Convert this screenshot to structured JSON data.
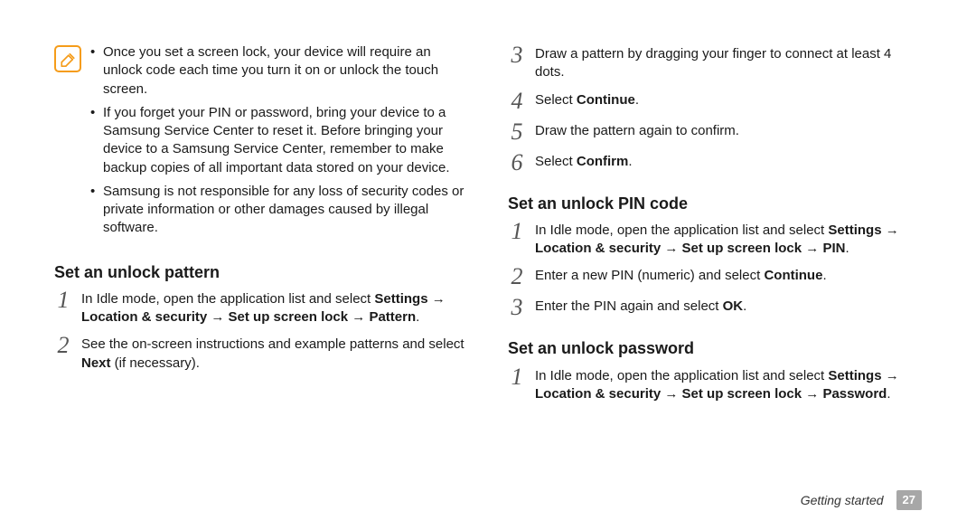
{
  "note": {
    "icon": "note-icon",
    "bullets": [
      "Once you set a screen lock, your device will require an unlock code each time you turn it on or unlock the touch screen.",
      "If you forget your PIN or password, bring your device to a Samsung Service Center to reset it. Before bringing your device to a Samsung Service Center, remember to make backup copies of all important data stored on your device.",
      "Samsung is not responsible for any loss of security codes or private information or other damages caused by illegal software."
    ]
  },
  "sections": {
    "pattern": {
      "heading": "Set an unlock pattern",
      "steps": [
        {
          "n": "1",
          "html": "In Idle mode, open the application list and select <b>Settings</b> → <b>Location & security</b> → <b>Set up screen lock</b> → <b>Pattern</b>."
        },
        {
          "n": "2",
          "html": "See the on-screen instructions and example patterns and select <b>Next</b> (if necessary)."
        }
      ]
    },
    "pattern_cont": {
      "steps": [
        {
          "n": "3",
          "html": "Draw a pattern by dragging your finger to connect at least 4 dots."
        },
        {
          "n": "4",
          "html": "Select <b>Continue</b>."
        },
        {
          "n": "5",
          "html": "Draw the pattern again to confirm."
        },
        {
          "n": "6",
          "html": "Select <b>Confirm</b>."
        }
      ]
    },
    "pin": {
      "heading": "Set an unlock PIN code",
      "steps": [
        {
          "n": "1",
          "html": "In Idle mode, open the application list and select <b>Settings</b> → <b>Location & security</b> → <b>Set up screen lock</b> → <b>PIN</b>."
        },
        {
          "n": "2",
          "html": "Enter a new PIN (numeric) and select <b>Continue</b>."
        },
        {
          "n": "3",
          "html": "Enter the PIN again and select <b>OK</b>."
        }
      ]
    },
    "password": {
      "heading": "Set an unlock password",
      "steps": [
        {
          "n": "1",
          "html": "In Idle mode, open the application list and select <b>Settings</b> → <b>Location & security</b> → <b>Set up screen lock</b> → <b>Password</b>."
        }
      ]
    }
  },
  "footer": {
    "section_label": "Getting started",
    "page": "27"
  }
}
